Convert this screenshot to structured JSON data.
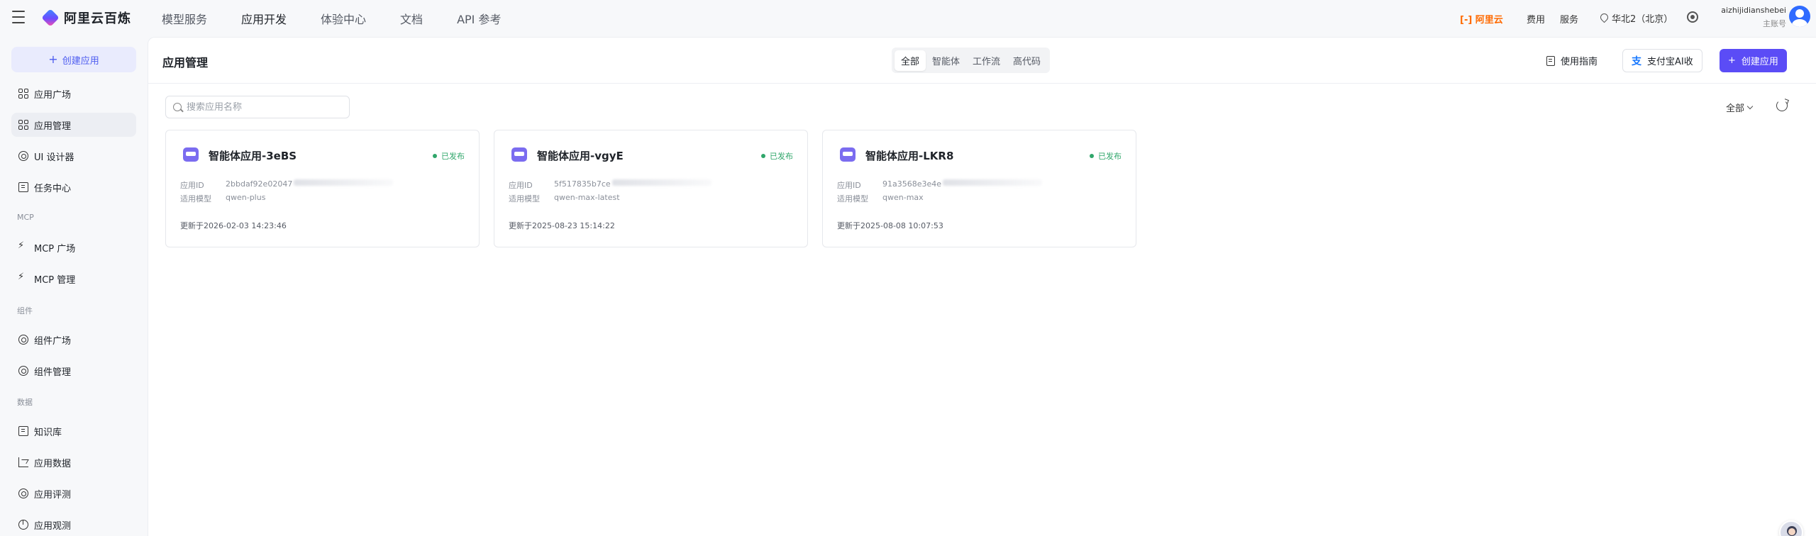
{
  "topbar": {
    "brand": "阿里云百炼",
    "nav": [
      "模型服务",
      "应用开发",
      "体验中心",
      "文档",
      "API 参考"
    ],
    "active_nav_index": 1,
    "aliyun_logo_text": "[-] 阿里云",
    "links": [
      "费用",
      "服务"
    ],
    "region": "华北2（北京）",
    "user_name": "aizhijidianshebei",
    "user_role": "主账号"
  },
  "sidebar": {
    "create_label": "创建应用",
    "items": [
      {
        "label": "应用广场",
        "icon": "grid-icon"
      },
      {
        "label": "应用管理",
        "icon": "grid-icon",
        "active": true
      },
      {
        "label": "UI 设计器",
        "icon": "palette-icon"
      },
      {
        "label": "任务中心",
        "icon": "task-icon"
      }
    ],
    "section_mcp": "MCP",
    "mcp_items": [
      {
        "label": "MCP 广场",
        "icon": "bolt-icon"
      },
      {
        "label": "MCP 管理",
        "icon": "bolt-settings-icon"
      }
    ],
    "section_component": "组件",
    "component_items": [
      {
        "label": "组件广场",
        "icon": "component-icon"
      },
      {
        "label": "组件管理",
        "icon": "component-settings-icon"
      }
    ],
    "section_data": "数据",
    "data_items": [
      {
        "label": "知识库",
        "icon": "book-icon"
      },
      {
        "label": "应用数据",
        "icon": "chart-icon"
      },
      {
        "label": "应用评测",
        "icon": "evaluation-icon"
      },
      {
        "label": "应用观测",
        "icon": "pie-icon"
      }
    ]
  },
  "main": {
    "title": "应用管理",
    "tabs": [
      "全部",
      "智能体",
      "工作流",
      "高代码"
    ],
    "active_tab_index": 0,
    "guide_label": "使用指南",
    "alipay_label": "支付宝AI收",
    "create_label": "创建应用",
    "search_placeholder": "搜索应用名称",
    "filter_label": "全部"
  },
  "cards": [
    {
      "title": "智能体应用-3eBS",
      "status": "已发布",
      "id_label": "应用ID",
      "id_value": "2bbdaf92e02047",
      "model_label": "适用模型",
      "model_value": "qwen-plus",
      "updated": "更新于2026-02-03 14:23:46"
    },
    {
      "title": "智能体应用-vgyE",
      "status": "已发布",
      "id_label": "应用ID",
      "id_value": "5f517835b7ce",
      "model_label": "适用模型",
      "model_value": "qwen-max-latest",
      "updated": "更新于2025-08-23 15:14:22"
    },
    {
      "title": "智能体应用-LKR8",
      "status": "已发布",
      "id_label": "应用ID",
      "id_value": "91a3568e3e4e",
      "model_label": "适用模型",
      "model_value": "qwen-max",
      "updated": "更新于2025-08-08 10:07:53"
    }
  ],
  "colors": {
    "primary": "#5b4cf6",
    "published": "#2fa66a",
    "brand_orange": "#ff6a00"
  }
}
